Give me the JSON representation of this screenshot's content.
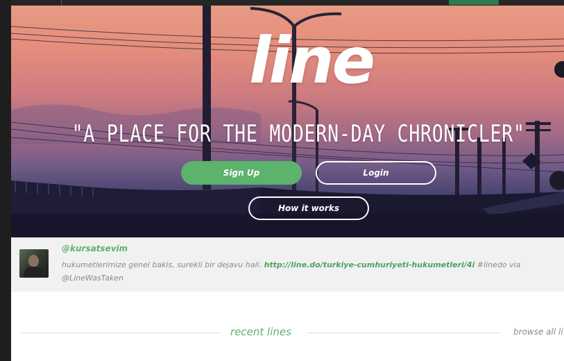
{
  "hero": {
    "logo": "line",
    "tagline": "\"A PLACE FOR THE MODERN-DAY CHRONICLER\"",
    "signup_label": "Sign Up",
    "login_label": "Login",
    "how_label": "How it works"
  },
  "tweet": {
    "user": "@kursatsevim",
    "text_before": "hukumetlerimize genel bakis, surekli bir dejavu hali. ",
    "link": "http://line.do/turkiye-cumhuriyeti-hukumetleri/4i",
    "text_after": " #linedo via @LineWasTaken"
  },
  "recent": {
    "title": "recent lines",
    "browse_all": "browse all li"
  },
  "colors": {
    "accent_green": "#5bb36c",
    "link_green": "#4ea25f",
    "text_gray": "#8a8a8a",
    "frame_dark": "#1e1e1e"
  },
  "icons": [
    "avatar-image"
  ]
}
